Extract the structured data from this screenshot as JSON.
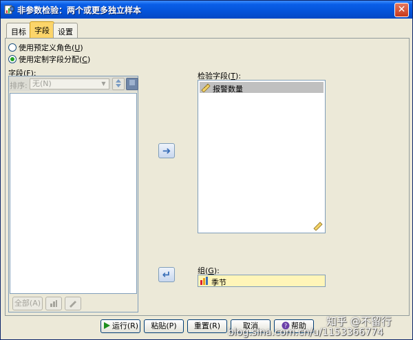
{
  "window": {
    "title": "非参数检验：两个或更多独立样本",
    "close_label": "✕"
  },
  "tabs": [
    {
      "label": "目标",
      "active": false
    },
    {
      "label": "字段",
      "active": true
    },
    {
      "label": "设置",
      "active": false
    }
  ],
  "options": {
    "predefined_roles": {
      "label": "使用预定义角色",
      "hotkey": "U",
      "checked": false
    },
    "custom_assignments": {
      "label": "使用定制字段分配",
      "hotkey": "C",
      "checked": true
    }
  },
  "fields_panel": {
    "label": "字段",
    "hotkey": "F",
    "sort_label": "排序:",
    "sort_value": "无(N)",
    "items": [],
    "all_button": "全部(A)"
  },
  "test_fields": {
    "label": "检验字段",
    "hotkey": "T",
    "items": [
      {
        "name": "报警数量",
        "icon": "scale-variable-icon"
      }
    ]
  },
  "groups": {
    "label": "组",
    "hotkey": "G",
    "value": "季节",
    "icon": "nominal-variable-icon"
  },
  "footer": {
    "run": "运行(R)",
    "paste": "粘贴(P)",
    "reset": "重置(R)",
    "cancel": "取消",
    "help": "帮助"
  },
  "watermark": {
    "text1": "知乎 @不留行",
    "text2": "blog.sina.com.cn/u/1153366774"
  },
  "colors": {
    "active_tab": "#fcd56a",
    "group_field_bg": "#fff5b8",
    "titlebar": "#0453d9"
  }
}
